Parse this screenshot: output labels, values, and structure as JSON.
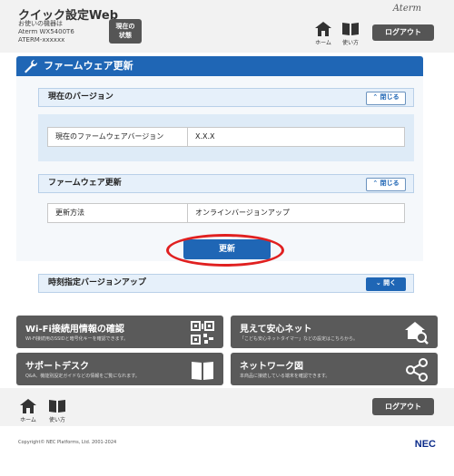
{
  "header": {
    "app_title": "クイック設定Web",
    "device_caption": "お使いの機器は",
    "device_model": "Aterm WX5400T6",
    "device_id": "ATERM-xxxxxx",
    "status_label_1": "現在の",
    "status_label_2": "状態",
    "brand": "Aterm",
    "home_label": "ホーム",
    "help_label": "使い方",
    "logout_label": "ログアウト"
  },
  "panel": {
    "title": "ファームウェア更新",
    "sections": [
      {
        "title": "現在のバージョン",
        "toggle": "閉じる"
      },
      {
        "title": "ファームウェア更新",
        "toggle": "閉じる"
      },
      {
        "title": "時刻指定バージョンアップ",
        "toggle": "開く"
      }
    ],
    "current_version": {
      "label": "現在のファームウェアバージョン",
      "value": "X.X.X"
    },
    "update_method": {
      "label": "更新方法",
      "value": "オンラインバージョンアップ"
    },
    "update_button": "更新"
  },
  "tiles": [
    {
      "title": "Wi-Fi接続用情報の確認",
      "desc": "Wi-Fi接続用のSSIDと暗号化キーを確認できます。",
      "icon": "qr-code-icon"
    },
    {
      "title": "見えて安心ネット",
      "desc": "「こども安心ネットタイマー」などの設定はこちらから。",
      "icon": "house-search-icon"
    },
    {
      "title": "サポートデスク",
      "desc": "Q&A、機能別設定ガイドなどの情報をご覧になれます。",
      "icon": "book-icon"
    },
    {
      "title": "ネットワーク図",
      "desc": "本商品に接続している端末を確認できます。",
      "icon": "network-icon"
    }
  ],
  "footer": {
    "home_label": "ホーム",
    "help_label": "使い方",
    "logout_label": "ログアウト",
    "copyright": "Copyright© NEC Platforms, Ltd. 2001-2024",
    "logo": "NEC"
  },
  "colors": {
    "accent": "#1f66b5",
    "highlight_ring": "#e02020",
    "tile_bg": "#5a5a5a"
  }
}
